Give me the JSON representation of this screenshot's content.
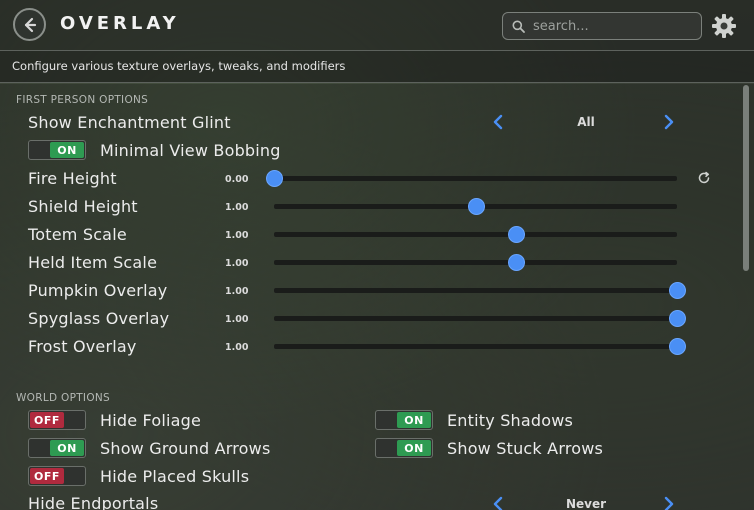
{
  "header": {
    "title": "OVERLAY",
    "search_placeholder": "search..."
  },
  "subtitle": "Configure various texture overlays, tweaks, and modifiers",
  "first_person": {
    "section_label": "FIRST PERSON OPTIONS",
    "enchantment_glint": {
      "label": "Show Enchantment Glint",
      "value": "All"
    },
    "view_bobbing": {
      "label": "Minimal View Bobbing",
      "state": "ON"
    },
    "sliders": [
      {
        "label": "Fire Height",
        "value": "0.00",
        "fraction": 0.0
      },
      {
        "label": "Shield Height",
        "value": "1.00",
        "fraction": 0.5
      },
      {
        "label": "Totem Scale",
        "value": "1.00",
        "fraction": 0.6
      },
      {
        "label": "Held Item Scale",
        "value": "1.00",
        "fraction": 0.6
      },
      {
        "label": "Pumpkin Overlay",
        "value": "1.00",
        "fraction": 1.0
      },
      {
        "label": "Spyglass Overlay",
        "value": "1.00",
        "fraction": 1.0
      },
      {
        "label": "Frost Overlay",
        "value": "1.00",
        "fraction": 1.0
      }
    ]
  },
  "world": {
    "section_label": "WORLD OPTIONS",
    "toggles": [
      {
        "label": "Hide Foliage",
        "state": "OFF"
      },
      {
        "label": "Entity Shadows",
        "state": "ON"
      },
      {
        "label": "Show Ground Arrows",
        "state": "ON"
      },
      {
        "label": "Show Stuck Arrows",
        "state": "ON"
      },
      {
        "label": "Hide Placed Skulls",
        "state": "OFF"
      }
    ],
    "endportals": {
      "label": "Hide Endportals",
      "value": "Never"
    }
  },
  "colors": {
    "accent": "#4a8ff5",
    "on": "#2e9b52",
    "off": "#b02a3e"
  }
}
